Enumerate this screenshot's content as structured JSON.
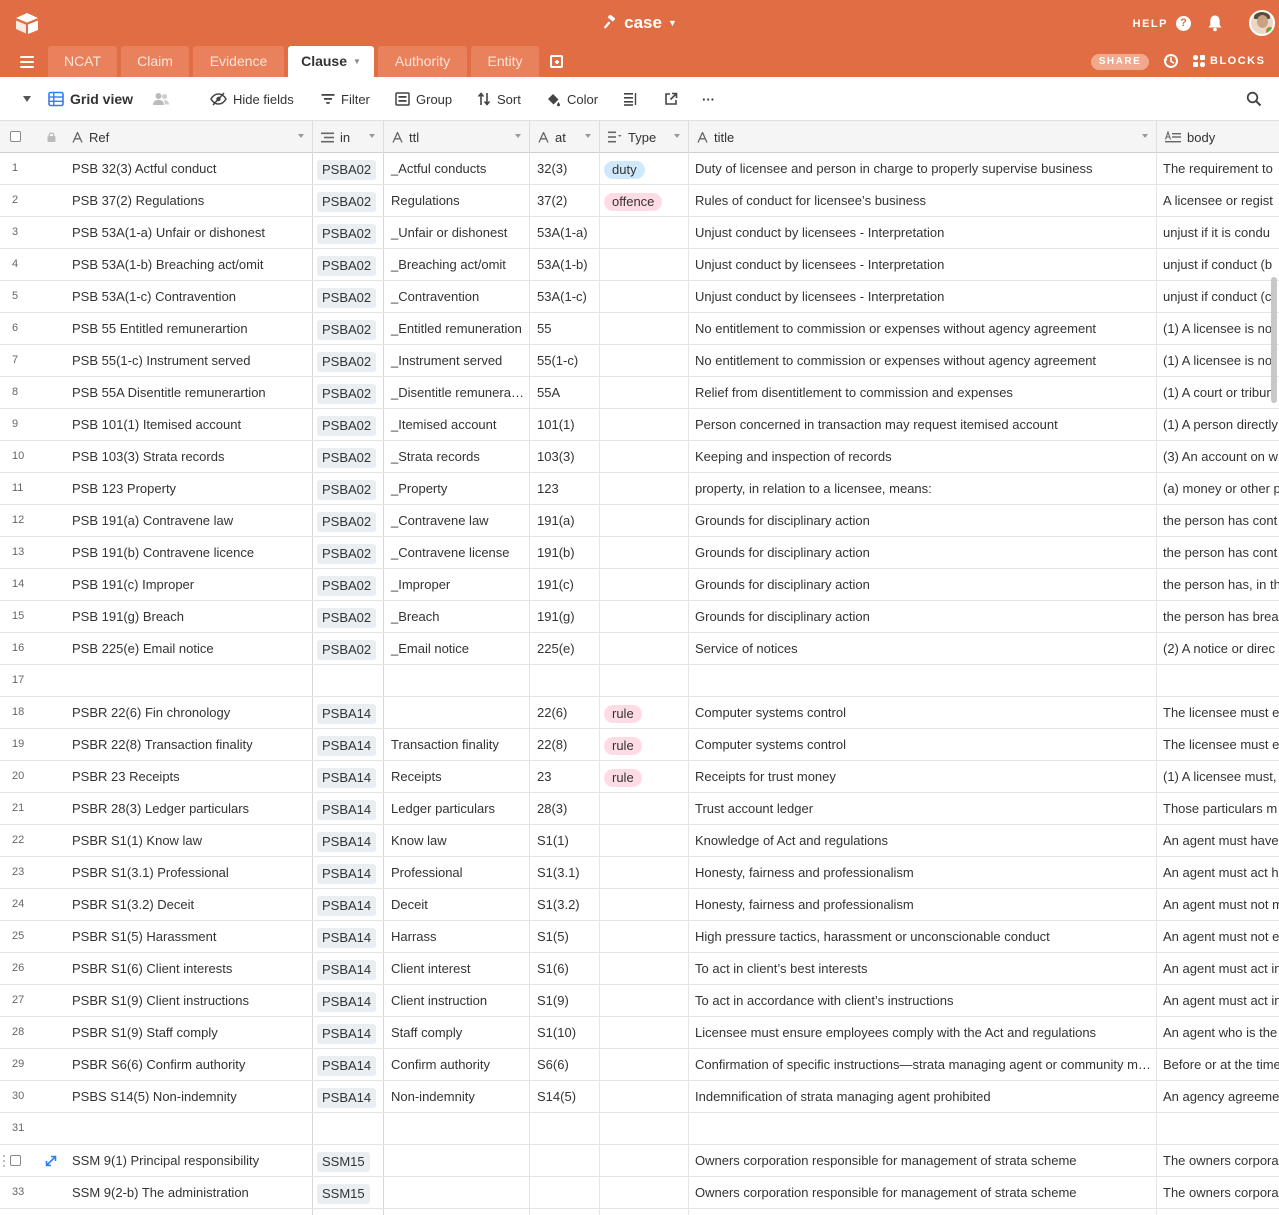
{
  "header": {
    "base_name": "case",
    "help_label": "HELP",
    "help_glyph": "?",
    "brand_color": "#e06d43"
  },
  "tabs": [
    {
      "label": "NCAT",
      "active": false
    },
    {
      "label": "Claim",
      "active": false
    },
    {
      "label": "Evidence",
      "active": false
    },
    {
      "label": "Clause",
      "active": true
    },
    {
      "label": "Authority",
      "active": false
    },
    {
      "label": "Entity",
      "active": false
    }
  ],
  "tabbar": {
    "share_label": "SHARE",
    "blocks_label": "BLOCKS"
  },
  "toolbar": {
    "view_name": "Grid view",
    "hide_fields": "Hide fields",
    "filter": "Filter",
    "group": "Group",
    "sort": "Sort",
    "color": "Color",
    "more": "···"
  },
  "columns": {
    "ref": "Ref",
    "in": "in",
    "ttl": "ttl",
    "at": "at",
    "type": "Type",
    "title": "title",
    "body": "body"
  },
  "type_colors": {
    "duty": "#cfe9fb",
    "offence": "#ffdce5",
    "rule": "#ffdce5"
  },
  "rows": [
    {
      "n": "1",
      "ref": "PSB 32(3) Actful conduct",
      "in": "PSBA02",
      "ttl": "_Actful conducts",
      "at": "32(3)",
      "type": "duty",
      "title": "Duty of licensee and person in charge to properly supervise business",
      "body": "The requirement to"
    },
    {
      "n": "2",
      "ref": "PSB 37(2) Regulations",
      "in": "PSBA02",
      "ttl": "Regulations",
      "at": "37(2)",
      "type": "offence",
      "title": "Rules of conduct for licensee’s business",
      "body": "A licensee or regist"
    },
    {
      "n": "3",
      "ref": "PSB 53A(1-a) Unfair or dishonest",
      "in": "PSBA02",
      "ttl": "_Unfair or dishonest",
      "at": "53A(1-a)",
      "type": "",
      "title": "Unjust conduct by licensees - Interpretation",
      "body": "unjust if it is condu"
    },
    {
      "n": "4",
      "ref": "PSB 53A(1-b) Breaching act/omit",
      "in": "PSBA02",
      "ttl": "_Breaching act/omit",
      "at": "53A(1-b)",
      "type": "",
      "title": "Unjust conduct by licensees - Interpretation",
      "body": "unjust if conduct (b"
    },
    {
      "n": "5",
      "ref": "PSB 53A(1-c) Contravention",
      "in": "PSBA02",
      "ttl": "_Contravention",
      "at": "53A(1-c)",
      "type": "",
      "title": "Unjust conduct by licensees - Interpretation",
      "body": "unjust if conduct (c"
    },
    {
      "n": "6",
      "ref": "PSB 55 Entitled remunerartion",
      "in": "PSBA02",
      "ttl": "_Entitled remuneration",
      "at": "55",
      "type": "",
      "title": "No entitlement to commission or expenses without agency agreement",
      "body": "(1) A licensee is not"
    },
    {
      "n": "7",
      "ref": "PSB 55(1-c) Instrument served",
      "in": "PSBA02",
      "ttl": "_Instrument served",
      "at": "55(1-c)",
      "type": "",
      "title": "No entitlement to commission or expenses without agency agreement",
      "body": "(1) A licensee is not"
    },
    {
      "n": "8",
      "ref": "PSB 55A Disentitle remunerartion",
      "in": "PSBA02",
      "ttl": "_Disentitle remuneration",
      "at": "55A",
      "type": "",
      "title": "Relief from disentitlement to commission and expenses",
      "body": "(1) A court or tribun"
    },
    {
      "n": "9",
      "ref": "PSB 101(1) Itemised account",
      "in": "PSBA02",
      "ttl": "_Itemised account",
      "at": "101(1)",
      "type": "",
      "title": "Person concerned in transaction may request itemised account",
      "body": "(1) A person directly"
    },
    {
      "n": "10",
      "ref": "PSB 103(3) Strata records",
      "in": "PSBA02",
      "ttl": "_Strata records",
      "at": "103(3)",
      "type": "",
      "title": "Keeping and inspection of records",
      "body": "(3) An account on w"
    },
    {
      "n": "11",
      "ref": "PSB 123 Property",
      "in": "PSBA02",
      "ttl": "_Property",
      "at": "123",
      "type": "",
      "title": "property, in relation to a licensee, means:",
      "body": "(a) money or other p"
    },
    {
      "n": "12",
      "ref": "PSB 191(a) Contravene law",
      "in": "PSBA02",
      "ttl": "_Contravene law",
      "at": "191(a)",
      "type": "",
      "title": "Grounds for disciplinary action",
      "body": "the person has cont"
    },
    {
      "n": "13",
      "ref": "PSB 191(b) Contravene licence",
      "in": "PSBA02",
      "ttl": "_Contravene license",
      "at": "191(b)",
      "type": "",
      "title": "Grounds for disciplinary action",
      "body": "the person has cont"
    },
    {
      "n": "14",
      "ref": "PSB 191(c) Improper",
      "in": "PSBA02",
      "ttl": "_Improper",
      "at": "191(c)",
      "type": "",
      "title": "Grounds for disciplinary action",
      "body": "the person has, in th"
    },
    {
      "n": "15",
      "ref": "PSB 191(g) Breach",
      "in": "PSBA02",
      "ttl": "_Breach",
      "at": "191(g)",
      "type": "",
      "title": "Grounds for disciplinary action",
      "body": "the person has brea"
    },
    {
      "n": "16",
      "ref": "PSB 225(e) Email notice",
      "in": "PSBA02",
      "ttl": "_Email notice",
      "at": "225(e)",
      "type": "",
      "title": "Service of notices",
      "body": "(2) A notice or direc"
    },
    {
      "n": "17",
      "ref": "",
      "in": "",
      "ttl": "",
      "at": "",
      "type": "",
      "title": "",
      "body": ""
    },
    {
      "n": "18",
      "ref": "PSBR 22(6) Fin chronology",
      "in": "PSBA14",
      "ttl": "",
      "at": "22(6)",
      "type": "rule",
      "title": "Computer systems control",
      "body": "The licensee must e"
    },
    {
      "n": "19",
      "ref": "PSBR 22(8) Transaction finality",
      "in": "PSBA14",
      "ttl": "Transaction finality",
      "at": "22(8)",
      "type": "rule",
      "title": "Computer systems control",
      "body": "The licensee must e"
    },
    {
      "n": "20",
      "ref": "PSBR 23 Receipts",
      "in": "PSBA14",
      "ttl": "Receipts",
      "at": "23",
      "type": "rule",
      "title": "Receipts for trust money",
      "body": "(1) A licensee must,"
    },
    {
      "n": "21",
      "ref": "PSBR 28(3) Ledger particulars",
      "in": "PSBA14",
      "ttl": "Ledger particulars",
      "at": "28(3)",
      "type": "",
      "title": "Trust account ledger",
      "body": "Those particulars m"
    },
    {
      "n": "22",
      "ref": "PSBR S1(1) Know law",
      "in": "PSBA14",
      "ttl": "Know law",
      "at": "S1(1)",
      "type": "",
      "title": "Knowledge of Act and regulations",
      "body": "An agent must have"
    },
    {
      "n": "23",
      "ref": "PSBR S1(3.1) Professional",
      "in": "PSBA14",
      "ttl": "Professional",
      "at": "S1(3.1)",
      "type": "",
      "title": "Honesty, fairness and professionalism",
      "body": "An agent must act h"
    },
    {
      "n": "24",
      "ref": "PSBR S1(3.2) Deceit",
      "in": "PSBA14",
      "ttl": "Deceit",
      "at": "S1(3.2)",
      "type": "",
      "title": "Honesty, fairness and professionalism",
      "body": "An agent must not m"
    },
    {
      "n": "25",
      "ref": "PSBR S1(5) Harassment",
      "in": "PSBA14",
      "ttl": "Harrass",
      "at": "S1(5)",
      "type": "",
      "title": "High pressure tactics, harassment or unconscionable conduct",
      "body": "An agent must not e"
    },
    {
      "n": "26",
      "ref": "PSBR S1(6) Client interests",
      "in": "PSBA14",
      "ttl": "Client interest",
      "at": "S1(6)",
      "type": "",
      "title": "To act in client’s best interests",
      "body": "An agent must act in"
    },
    {
      "n": "27",
      "ref": "PSBR S1(9) Client instructions",
      "in": "PSBA14",
      "ttl": "Client instruction",
      "at": "S1(9)",
      "type": "",
      "title": "To act in accordance with client’s instructions",
      "body": "An agent must act in"
    },
    {
      "n": "28",
      "ref": "PSBR S1(9) Staff comply",
      "in": "PSBA14",
      "ttl": "Staff comply",
      "at": "S1(10)",
      "type": "",
      "title": "Licensee must ensure employees comply with the Act and regulations",
      "body": "An agent who is the"
    },
    {
      "n": "29",
      "ref": "PSBR S6(6) Confirm authority",
      "in": "PSBA14",
      "ttl": "Confirm authority",
      "at": "S6(6)",
      "type": "",
      "title": "Confirmation of specific instructions—strata managing agent or community managing agent",
      "body": "Before or at the time"
    },
    {
      "n": "30",
      "ref": "PSBS S14(5) Non-indemnity",
      "in": "PSBA14",
      "ttl": "Non-indemnity",
      "at": "S14(5)",
      "type": "",
      "title": "Indemnification of strata managing agent prohibited",
      "body": "An agency agreeme"
    },
    {
      "n": "31",
      "ref": "",
      "in": "",
      "ttl": "",
      "at": "",
      "type": "",
      "title": "",
      "body": ""
    },
    {
      "n": "",
      "ref": "SSM 9(1) Principal responsibility",
      "in": "SSM15",
      "ttl": "",
      "at": "",
      "type": "",
      "title": "Owners corporation responsible for management of strata scheme",
      "body": "The owners corpora",
      "hover": true
    },
    {
      "n": "33",
      "ref": "SSM 9(2-b) The administration",
      "in": "SSM15",
      "ttl": "",
      "at": "",
      "type": "",
      "title": "Owners corporation responsible for management of strata scheme",
      "body": "The owners corpora"
    },
    {
      "n": "",
      "ref": "",
      "in": "",
      "ttl": "",
      "at": "",
      "type": "",
      "title": "",
      "body": ""
    }
  ]
}
